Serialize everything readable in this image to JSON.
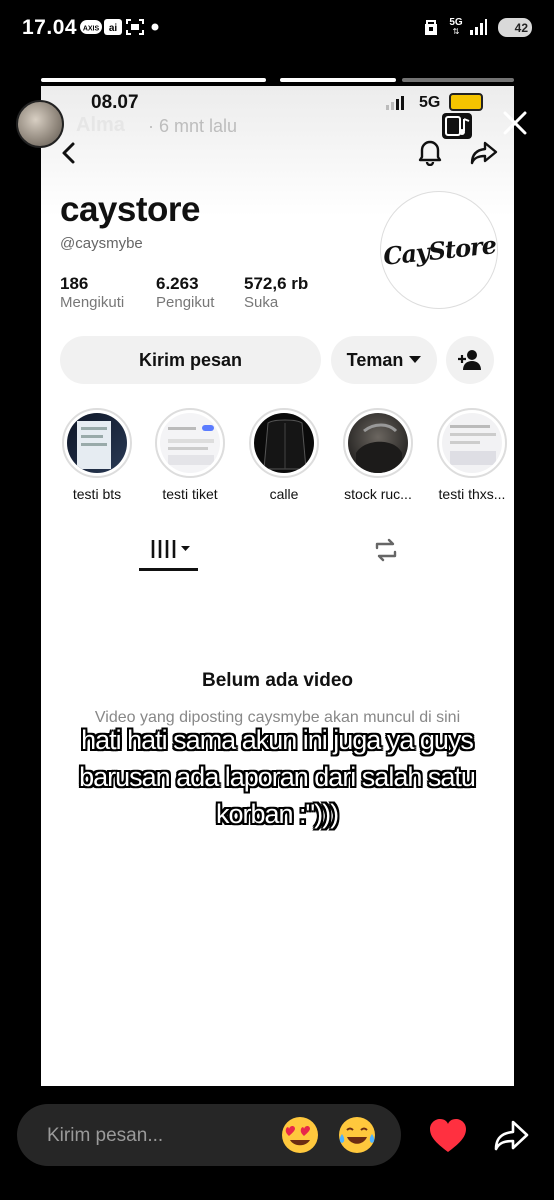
{
  "status_bar": {
    "time": "17.04",
    "network": "5G",
    "battery": "42",
    "icons": [
      "axis-icon",
      "ai-icon",
      "screen-record-icon",
      "dot-icon",
      "vpn-icon",
      "signal-icon"
    ]
  },
  "story": {
    "username": "Alma",
    "time_ago": "6 mnt lalu",
    "progress_segments": [
      1,
      1,
      0
    ],
    "caption_lines": [
      "hati hati sama akun ini juga ya guys",
      "barusan ada laporan dari salah satu",
      "korban :\")))"
    ]
  },
  "screenshot": {
    "status_time": "08.07",
    "status_network": "5G",
    "profile_name": "caystore",
    "handle": "@caysmybe",
    "logo_text": "CayStore",
    "stats": [
      {
        "value": "186",
        "label": "Mengikuti"
      },
      {
        "value": "6.263",
        "label": "Pengikut"
      },
      {
        "value": "572,6 rb",
        "label": "Suka"
      }
    ],
    "buttons": {
      "message": "Kirim pesan",
      "friend": "Teman"
    },
    "highlights": [
      {
        "label": "testi bts"
      },
      {
        "label": "testi tiket"
      },
      {
        "label": "calle"
      },
      {
        "label": "stock ruc..."
      },
      {
        "label": "testi thxs..."
      }
    ],
    "empty_title": "Belum ada video",
    "empty_desc": "Video yang diposting caysmybe akan muncul di sini"
  },
  "reply_bar": {
    "placeholder": "Kirim pesan...",
    "reactions": [
      "heart-eyes-emoji",
      "tears-of-joy-emoji"
    ]
  },
  "colors": {
    "accent_heart": "#ff3040",
    "battery_yellow": "#f5c400"
  }
}
